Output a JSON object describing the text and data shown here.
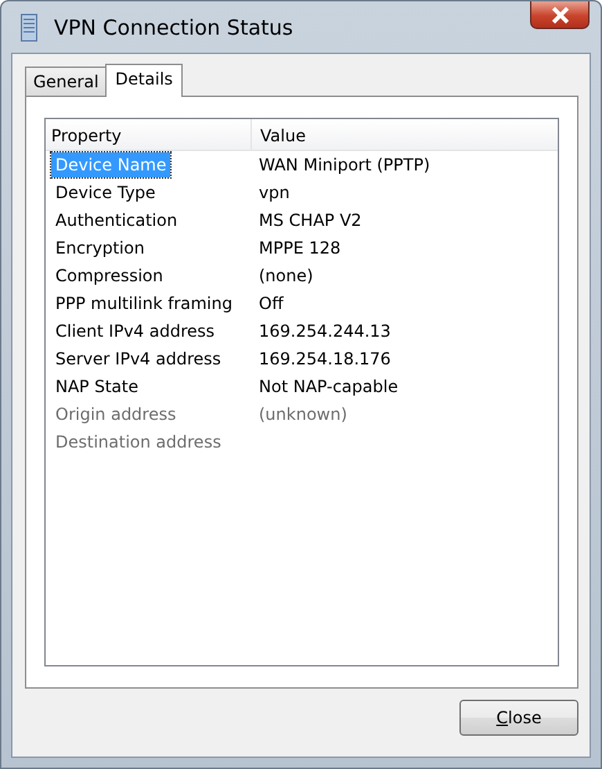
{
  "window": {
    "title": "VPN Connection Status"
  },
  "tabs": [
    {
      "label": "General",
      "selected": false
    },
    {
      "label": "Details",
      "selected": true
    }
  ],
  "table": {
    "columns": [
      "Property",
      "Value"
    ],
    "rows": [
      {
        "property": "Device Name",
        "value": "WAN Miniport (PPTP)",
        "selected": true,
        "disabled": false
      },
      {
        "property": "Device Type",
        "value": "vpn",
        "selected": false,
        "disabled": false
      },
      {
        "property": "Authentication",
        "value": "MS CHAP V2",
        "selected": false,
        "disabled": false
      },
      {
        "property": "Encryption",
        "value": "MPPE 128",
        "selected": false,
        "disabled": false
      },
      {
        "property": "Compression",
        "value": "(none)",
        "selected": false,
        "disabled": false
      },
      {
        "property": "PPP multilink framing",
        "value": "Off",
        "selected": false,
        "disabled": false
      },
      {
        "property": "Client IPv4 address",
        "value": "169.254.244.13",
        "selected": false,
        "disabled": false
      },
      {
        "property": "Server IPv4 address",
        "value": "169.254.18.176",
        "selected": false,
        "disabled": false
      },
      {
        "property": "NAP State",
        "value": "Not NAP-capable",
        "selected": false,
        "disabled": false
      },
      {
        "property": "Origin address",
        "value": "(unknown)",
        "selected": false,
        "disabled": true
      },
      {
        "property": "Destination address",
        "selected": false,
        "disabled": true
      }
    ]
  },
  "buttons": [
    {
      "label": "Close",
      "mnemonic_underlined": true
    }
  ]
}
